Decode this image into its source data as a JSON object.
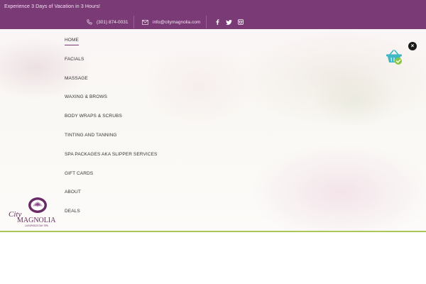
{
  "topbar": {
    "tagline": "Experience 3 Days of Vacation in 3 Hours!",
    "phone": "(301) 874-0031",
    "email": "info@citymagnolia.com",
    "social_icons": [
      "facebook-icon",
      "twitter-icon",
      "instagram-icon"
    ],
    "background": "#7a3a76"
  },
  "nav": {
    "items": [
      {
        "label": "HOME",
        "active": true
      },
      {
        "label": "FACIALS",
        "active": false
      },
      {
        "label": "MASSAGE",
        "active": false
      },
      {
        "label": "WAXING & BROWS",
        "active": false
      },
      {
        "label": "BODY WRAPS & SCRUBS",
        "active": false
      },
      {
        "label": "TINTING AND TANNING",
        "active": false
      },
      {
        "label": "SPA PACKAGES AKA SLIPPER SERVICES",
        "active": false
      },
      {
        "label": "GIFT CARDS",
        "active": false
      },
      {
        "label": "ABOUT",
        "active": false
      },
      {
        "label": "DEALS",
        "active": false
      }
    ]
  },
  "logo": {
    "line1": "City",
    "line2": "MAGNOLIA",
    "line3": "LUXURIOUS DAY SPA"
  },
  "cart": {
    "icon": "shopping-basket-icon"
  },
  "close": {
    "label": "×"
  },
  "colors": {
    "brand": "#7a3a76",
    "accent_line": "#a9c75a",
    "cart_teal": "#3fb7c4",
    "cart_check": "#8cc63f"
  }
}
